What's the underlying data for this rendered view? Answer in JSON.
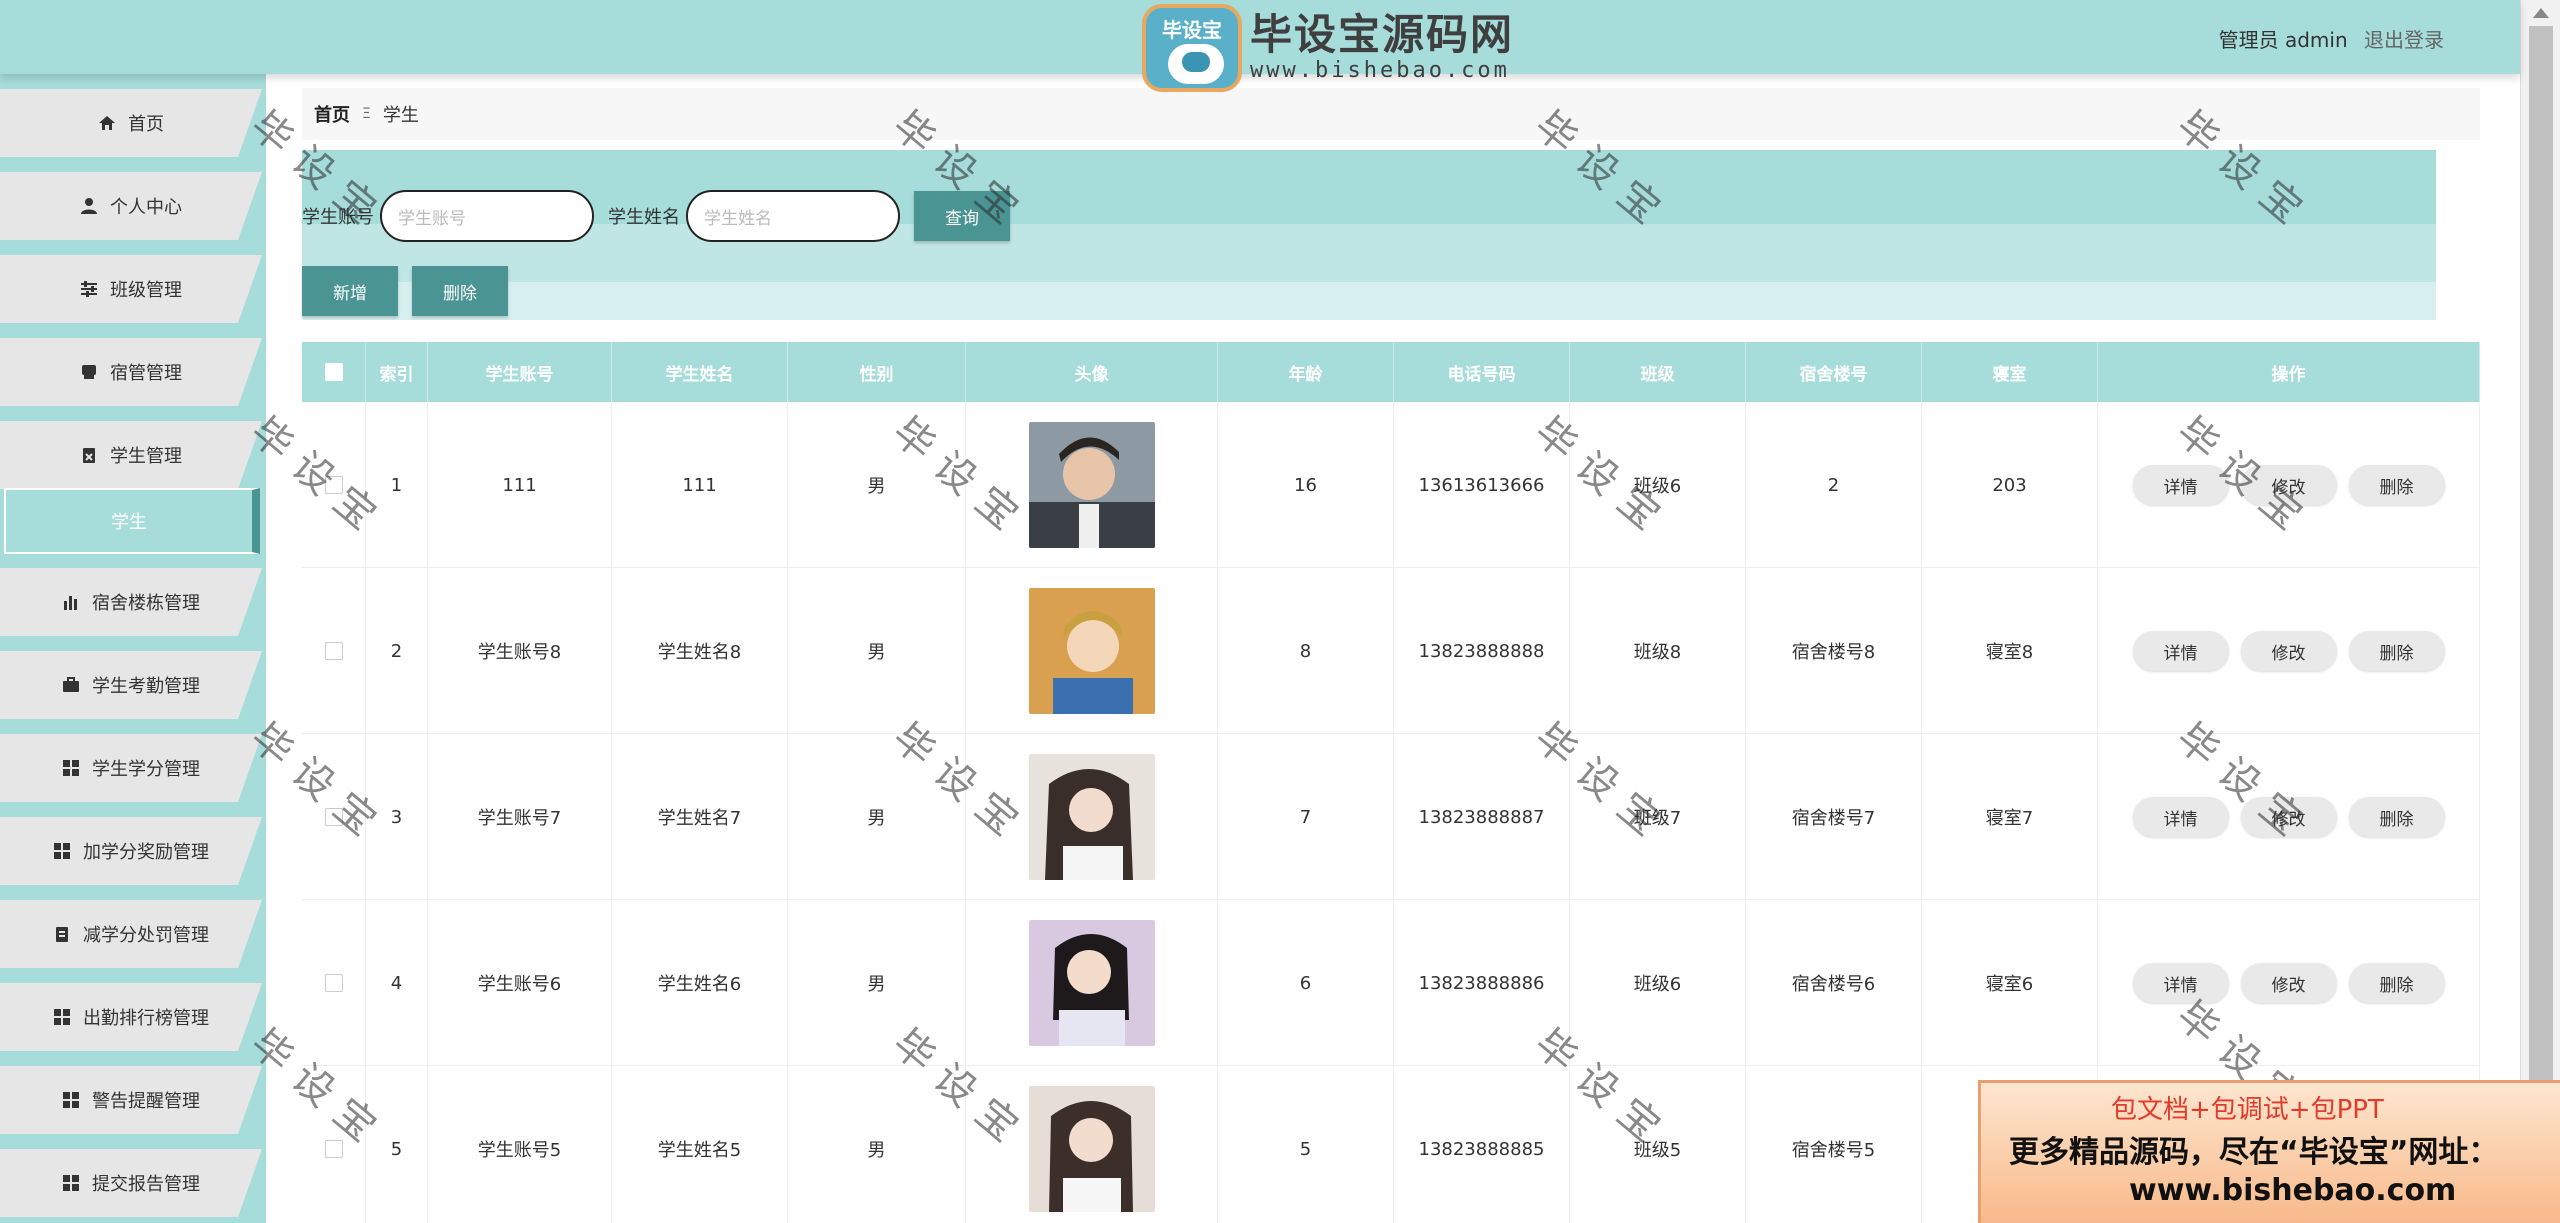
{
  "brand": {
    "badge_text": "毕设宝",
    "title": "毕设宝源码网",
    "url": "www.bishebao.com"
  },
  "header": {
    "role": "管理员 admin",
    "logout": "退出登录"
  },
  "sidebar": {
    "items": [
      {
        "label": "首页",
        "icon": "home-icon"
      },
      {
        "label": "个人中心",
        "icon": "user-icon"
      },
      {
        "label": "班级管理",
        "icon": "sliders-icon"
      },
      {
        "label": "宿管管理",
        "icon": "inbox-icon"
      },
      {
        "label": "学生管理",
        "icon": "clipboard-icon"
      },
      {
        "label": "宿舍楼栋管理",
        "icon": "bar-chart-icon"
      },
      {
        "label": "学生考勤管理",
        "icon": "briefcase-icon"
      },
      {
        "label": "学生学分管理",
        "icon": "grid-icon"
      },
      {
        "label": "加学分奖励管理",
        "icon": "grid-icon"
      },
      {
        "label": "减学分处罚管理",
        "icon": "clipboard-list-icon"
      },
      {
        "label": "出勤排行榜管理",
        "icon": "grid-icon"
      },
      {
        "label": "警告提醒管理",
        "icon": "grid-icon"
      },
      {
        "label": "提交报告管理",
        "icon": "grid-icon"
      }
    ],
    "active_sub": "学生"
  },
  "breadcrumb": {
    "home": "首页",
    "separator": "Ξ",
    "current": "学生"
  },
  "search": {
    "account_label": "学生账号",
    "account_placeholder": "学生账号",
    "name_label": "学生姓名",
    "name_placeholder": "学生姓名",
    "query_button": "查询"
  },
  "actions": {
    "add": "新增",
    "delete": "删除"
  },
  "table": {
    "headers": [
      "索引",
      "学生账号",
      "学生姓名",
      "性别",
      "头像",
      "年龄",
      "电话号码",
      "班级",
      "宿舍楼号",
      "寝室",
      "操作"
    ],
    "row_actions": [
      "详情",
      "修改",
      "删除"
    ],
    "rows": [
      {
        "index": "1",
        "account": "111",
        "name": "111",
        "gender": "男",
        "avatar": "avatar-1",
        "age": "16",
        "phone": "13613613666",
        "class": "班级6",
        "building": "2",
        "room": "203"
      },
      {
        "index": "2",
        "account": "学生账号8",
        "name": "学生姓名8",
        "gender": "男",
        "avatar": "avatar-2",
        "age": "8",
        "phone": "13823888888",
        "class": "班级8",
        "building": "宿舍楼号8",
        "room": "寝室8"
      },
      {
        "index": "3",
        "account": "学生账号7",
        "name": "学生姓名7",
        "gender": "男",
        "avatar": "avatar-3",
        "age": "7",
        "phone": "13823888887",
        "class": "班级7",
        "building": "宿舍楼号7",
        "room": "寝室7"
      },
      {
        "index": "4",
        "account": "学生账号6",
        "name": "学生姓名6",
        "gender": "男",
        "avatar": "avatar-4",
        "age": "6",
        "phone": "13823888886",
        "class": "班级6",
        "building": "宿舍楼号6",
        "room": "寝室6"
      },
      {
        "index": "5",
        "account": "学生账号5",
        "name": "学生姓名5",
        "gender": "男",
        "avatar": "avatar-5",
        "age": "5",
        "phone": "13823888885",
        "class": "班级5",
        "building": "宿舍楼号5",
        "room": ""
      }
    ]
  },
  "watermark": "毕设宝",
  "ad": {
    "line1": "包文档+包调试+包PPT",
    "line2": "更多精品源码，尽在“毕设宝”网址：",
    "line3": "www.bishebao.com"
  },
  "colors": {
    "theme": "#a6dcd9",
    "primary_button": "#4a9493",
    "sidebar_item": "#e6e6e6"
  }
}
